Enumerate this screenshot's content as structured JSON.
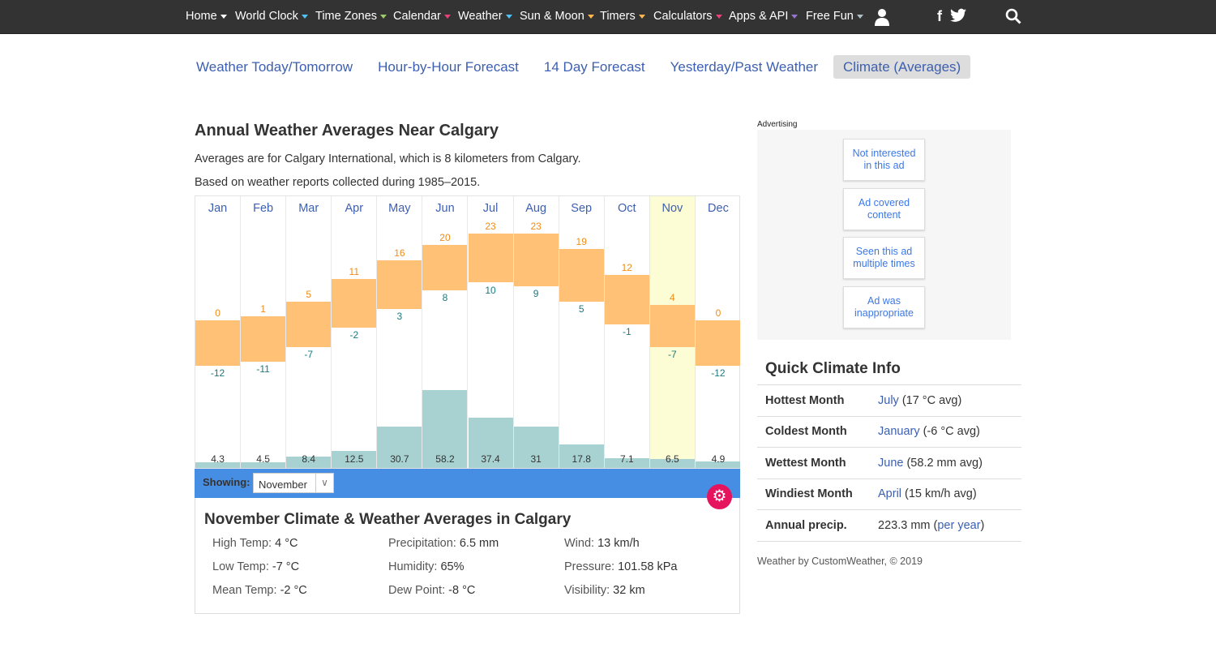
{
  "nav": {
    "items": [
      {
        "label": "Home",
        "color": "#ffffff"
      },
      {
        "label": "World Clock",
        "color": "#4fc3f7"
      },
      {
        "label": "Time Zones",
        "color": "#9ccc65"
      },
      {
        "label": "Calendar",
        "color": "#ec407a"
      },
      {
        "label": "Weather",
        "color": "#4fc3f7"
      },
      {
        "label": "Sun & Moon",
        "color": "#ffb74d"
      },
      {
        "label": "Timers",
        "color": "#ffb74d"
      },
      {
        "label": "Calculators",
        "color": "#ec407a"
      },
      {
        "label": "Apps & API",
        "color": "#9575cd"
      },
      {
        "label": "Free Fun",
        "color": "#b0bec5"
      }
    ],
    "icons": [
      "user-icon",
      "facebook-icon",
      "twitter-icon",
      "search-icon"
    ]
  },
  "subnav": {
    "tabs": [
      "Weather Today/Tomorrow",
      "Hour-by-Hour Forecast",
      "14 Day Forecast",
      "Yesterday/Past Weather",
      "Climate (Averages)"
    ],
    "active": 4
  },
  "title": "Annual Weather Averages Near Calgary",
  "intro1": "Averages are for Calgary International, which is 8 kilometers from Calgary.",
  "intro2": "Based on weather reports collected during 1985–2015.",
  "chart_data": {
    "type": "bar",
    "categories": [
      "Jan",
      "Feb",
      "Mar",
      "Apr",
      "May",
      "Jun",
      "Jul",
      "Aug",
      "Sep",
      "Oct",
      "Nov",
      "Dec"
    ],
    "series": [
      {
        "name": "High",
        "values": [
          0,
          1,
          5,
          11,
          16,
          20,
          23,
          23,
          19,
          12,
          4,
          0
        ]
      },
      {
        "name": "Low",
        "values": [
          -12,
          -11,
          -7,
          -2,
          3,
          8,
          10,
          9,
          5,
          -1,
          -7,
          -12
        ]
      },
      {
        "name": "Precipitation",
        "values": [
          4.3,
          4.5,
          8.4,
          12.5,
          30.7,
          58.2,
          37.4,
          31,
          17.8,
          7.1,
          6.5,
          4.9
        ]
      }
    ],
    "highlighted": "Nov",
    "colors": {
      "temp": "#ffc176",
      "high_label": "#f08c19",
      "low_label": "#1b7a7e",
      "precip": "#a8d2d2",
      "highlight": "#fdfdd5",
      "month": "#3d5fb0"
    }
  },
  "showing": {
    "label": "Showing:",
    "value": "November"
  },
  "details": {
    "title": "November Climate & Weather Averages in Calgary",
    "items": [
      {
        "k": "High Temp:",
        "v": "4 °C"
      },
      {
        "k": "Precipitation:",
        "v": "6.5 mm"
      },
      {
        "k": "Wind:",
        "v": "13 km/h"
      },
      {
        "k": "Low Temp:",
        "v": "-7 °C"
      },
      {
        "k": "Humidity:",
        "v": "65%"
      },
      {
        "k": "Pressure:",
        "v": "101.58 kPa"
      },
      {
        "k": "Mean Temp:",
        "v": "-2 °C"
      },
      {
        "k": "Dew Point:",
        "v": "-8 °C"
      },
      {
        "k": "Visibility:",
        "v": "32 km"
      }
    ]
  },
  "ad": {
    "label": "Advertising",
    "buttons": [
      "Not interested in this ad",
      "Ad covered content",
      "Seen this ad multiple times",
      "Ad was inappropriate"
    ]
  },
  "quick": {
    "title": "Quick Climate Info",
    "rows": [
      {
        "k": "Hottest Month",
        "link": "July",
        "rest": " (17 °C avg)"
      },
      {
        "k": "Coldest Month",
        "link": "January",
        "rest": " (-6 °C avg)"
      },
      {
        "k": "Wettest Month",
        "link": "June",
        "rest": " (58.2 mm avg)"
      },
      {
        "k": "Windiest Month",
        "link": "April",
        "rest": " (15 km/h avg)"
      },
      {
        "k": "Annual precip.",
        "pre": "223.3 mm (",
        "link": "per year",
        "rest": ")"
      }
    ]
  },
  "credit": "Weather by CustomWeather, © 2019"
}
